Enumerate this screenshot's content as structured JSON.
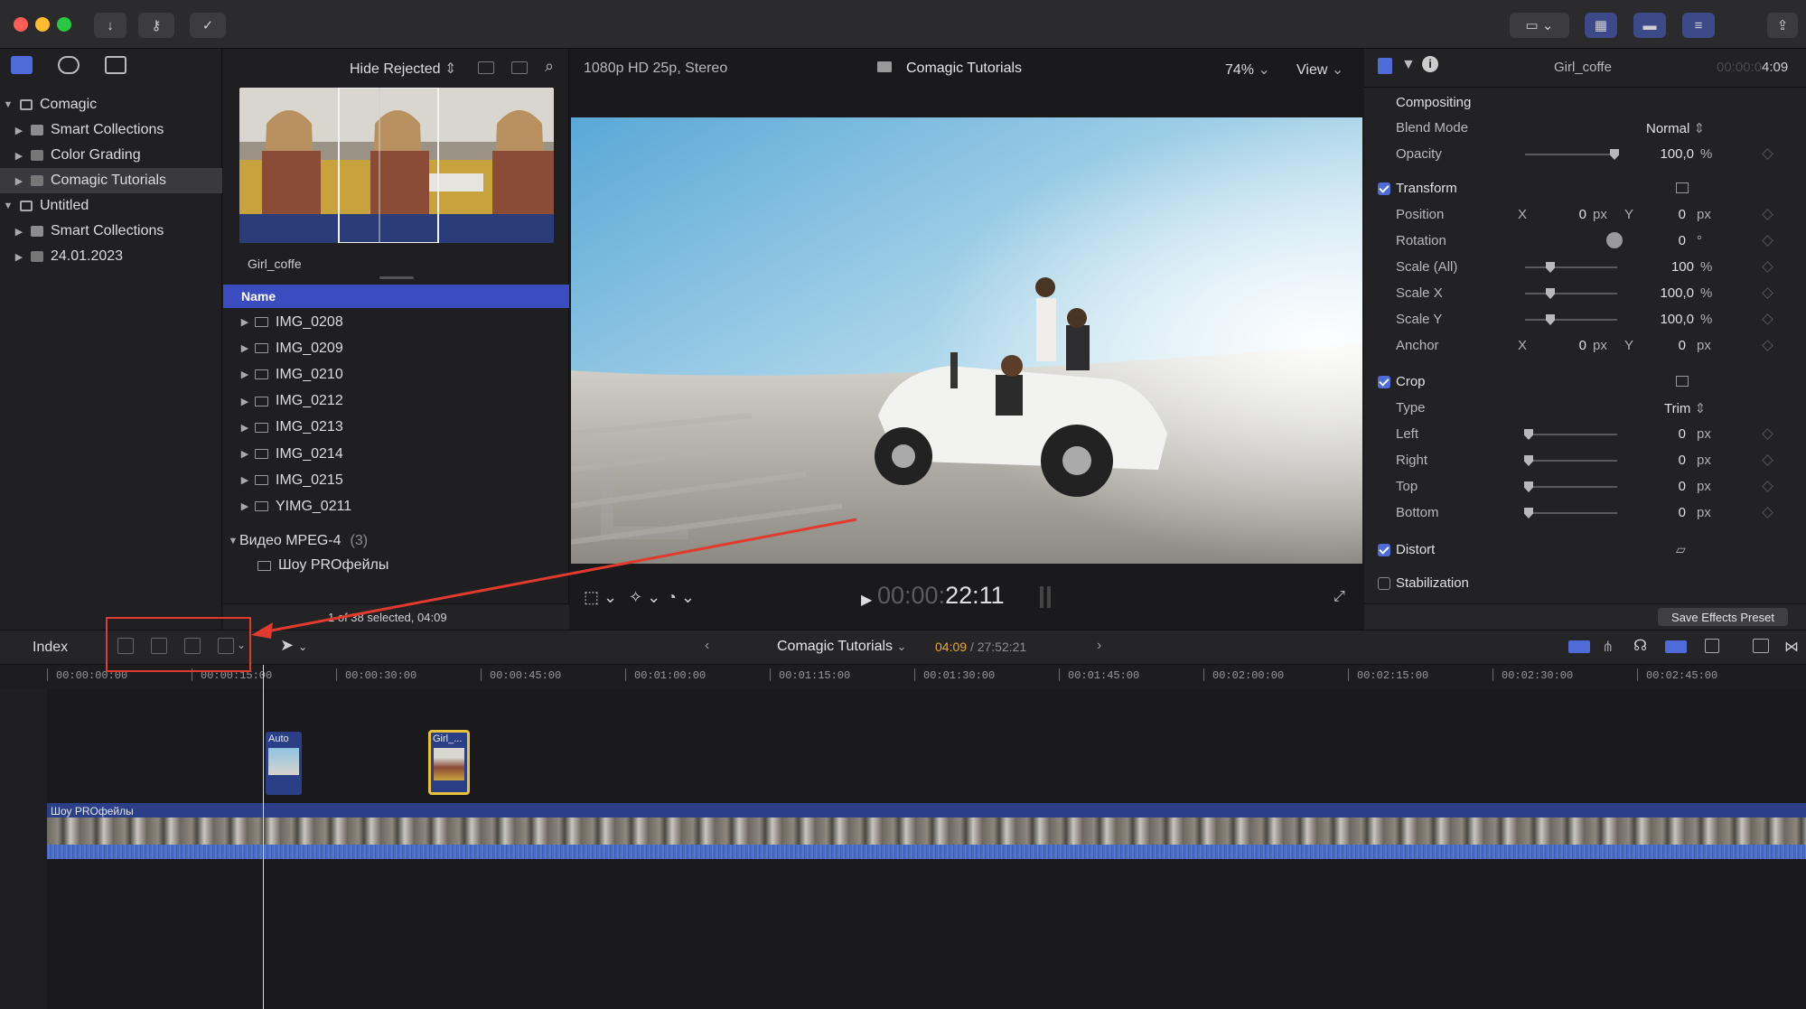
{
  "colors": {
    "accent": "#4e6bd8",
    "selection": "#3b4bc0",
    "annotation": "#e23a2f",
    "playhead_gold": "#e8c23a",
    "timecode_orange": "#e8a83a"
  },
  "library": {
    "items": [
      {
        "label": "Comagic",
        "level": 0,
        "expanded": true,
        "icon": "library-icon"
      },
      {
        "label": "Smart Collections",
        "level": 1,
        "expanded": false,
        "icon": "folder-icon"
      },
      {
        "label": "Color Grading",
        "level": 1,
        "expanded": false,
        "icon": "event-icon"
      },
      {
        "label": "Comagic Tutorials",
        "level": 1,
        "expanded": false,
        "icon": "event-icon",
        "selected": true
      },
      {
        "label": "Untitled",
        "level": 0,
        "expanded": true,
        "icon": "library-icon"
      },
      {
        "label": "Smart Collections",
        "level": 1,
        "expanded": false,
        "icon": "folder-icon"
      },
      {
        "label": "24.01.2023",
        "level": 1,
        "expanded": false,
        "icon": "event-icon"
      }
    ]
  },
  "browser": {
    "filter": "Hide Rejected",
    "filmstrip_caption": "Girl_coffe",
    "column_name": "Name",
    "clips": [
      "IMG_0208",
      "IMG_0209",
      "IMG_0210",
      "IMG_0212",
      "IMG_0213",
      "IMG_0214",
      "IMG_0215",
      "YIMG_0211"
    ],
    "group_label": "Видео MPEG-4",
    "group_count": "(3)",
    "group_item": "Шоу PROфейлы",
    "status": "1 of 38 selected, 04:09"
  },
  "viewer": {
    "format": "1080p HD 25p, Stereo",
    "project": "Comagic Tutorials",
    "zoom": "74%",
    "view_label": "View",
    "timecode_dim": "00:00:",
    "timecode_bright": "22:11"
  },
  "inspector": {
    "clip_name": "Girl_coffe",
    "clip_duration_dim": "00:00:0",
    "clip_duration": "4:09",
    "compositing": "Compositing",
    "blend_mode_label": "Blend Mode",
    "blend_mode_value": "Normal",
    "opacity_label": "Opacity",
    "opacity_value": "100,0",
    "opacity_unit": "%",
    "opacity_level": 1.0,
    "transform": "Transform",
    "position_label": "Position",
    "x_label": "X",
    "y_label": "Y",
    "position_x": "0",
    "position_y": "0",
    "px": "px",
    "rotation_label": "Rotation",
    "rotation_value": "0",
    "deg": "°",
    "scale_all_label": "Scale (All)",
    "scale_all_value": "100",
    "scale_x_label": "Scale X",
    "scale_x_value": "100,0",
    "scale_y_label": "Scale Y",
    "scale_y_value": "100,0",
    "pct": "%",
    "anchor_label": "Anchor",
    "anchor_x": "0",
    "anchor_y": "0",
    "crop": "Crop",
    "type_label": "Type",
    "type_value": "Trim",
    "left_label": "Left",
    "right_label": "Right",
    "top_label": "Top",
    "bottom_label": "Bottom",
    "zero": "0",
    "distort": "Distort",
    "stabilization": "Stabilization",
    "save_preset": "Save Effects Preset"
  },
  "timeline": {
    "index_label": "Index",
    "project": "Comagic Tutorials",
    "position_current": "04:09",
    "position_total": "/ 27:52:21",
    "ruler": [
      "00:00:00:00",
      "00:00:15:00",
      "00:00:30:00",
      "00:00:45:00",
      "00:01:00:00",
      "00:01:15:00",
      "00:01:30:00",
      "00:01:45:00",
      "00:02:00:00",
      "00:02:15:00",
      "00:02:30:00",
      "00:02:45:00"
    ],
    "connected_clip_1": "Auto",
    "connected_clip_2": "Girl_...",
    "primary_clip": "Шоу PROфейлы"
  }
}
